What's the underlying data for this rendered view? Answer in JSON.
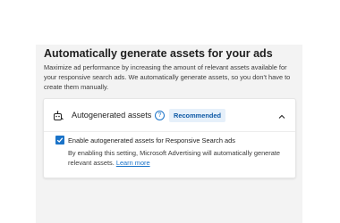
{
  "section": {
    "title": "Automatically generate assets for your ads",
    "description": "Maximize ad performance by increasing the amount of relevant assets available for your responsive search ads. We automatically generate assets, so you don't have to create them manually."
  },
  "card": {
    "icon": "robot-icon",
    "title": "Autogenerated assets",
    "info_icon": "info-icon",
    "badge": "Recommended",
    "collapse_icon": "chevron-up-icon"
  },
  "option": {
    "checked": true,
    "label": "Enable autogenerated assets for Responsive Search ads",
    "help_text": "By enabling this setting, Microsoft Advertising will automatically generate relevant assets.",
    "learn_more": "Learn more"
  },
  "colors": {
    "accent": "#1a73c8",
    "badge_bg": "#e6f0fa",
    "panel_bg": "#f3f3f3"
  }
}
